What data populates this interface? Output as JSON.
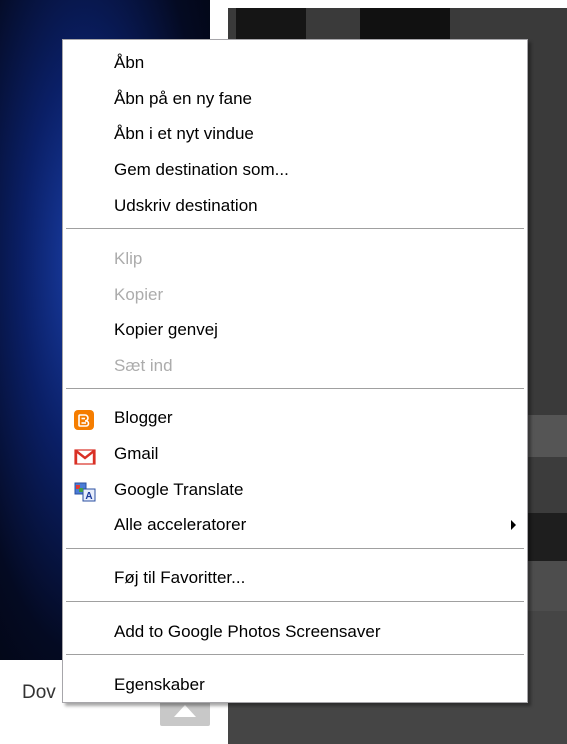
{
  "background": {
    "partial_link_text": "Dov"
  },
  "menu": {
    "groups": [
      [
        {
          "label": "Åbn",
          "enabled": true
        },
        {
          "label": "Åbn på en ny fane",
          "enabled": true
        },
        {
          "label": "Åbn i et nyt vindue",
          "enabled": true
        },
        {
          "label": "Gem destination som...",
          "enabled": true
        },
        {
          "label": "Udskriv destination",
          "enabled": true
        }
      ],
      [
        {
          "label": "Klip",
          "enabled": false
        },
        {
          "label": "Kopier",
          "enabled": false
        },
        {
          "label": "Kopier genvej",
          "enabled": true
        },
        {
          "label": "Sæt ind",
          "enabled": false
        }
      ],
      [
        {
          "label": "Blogger",
          "icon": "blogger-icon",
          "enabled": true
        },
        {
          "label": "Gmail",
          "icon": "gmail-icon",
          "enabled": true
        },
        {
          "label": "Google Translate",
          "icon": "google-translate-icon",
          "enabled": true
        },
        {
          "label": "Alle acceleratorer",
          "submenu": true,
          "enabled": true
        }
      ],
      [
        {
          "label": "Føj til Favoritter...",
          "enabled": true
        }
      ],
      [
        {
          "label": "Add to Google Photos Screensaver",
          "enabled": true
        }
      ],
      [
        {
          "label": "Egenskaber",
          "enabled": true
        }
      ]
    ]
  },
  "colors": {
    "blogger": "#f57d00",
    "gmail": "#d93025",
    "disabled_text": "#acacac"
  }
}
